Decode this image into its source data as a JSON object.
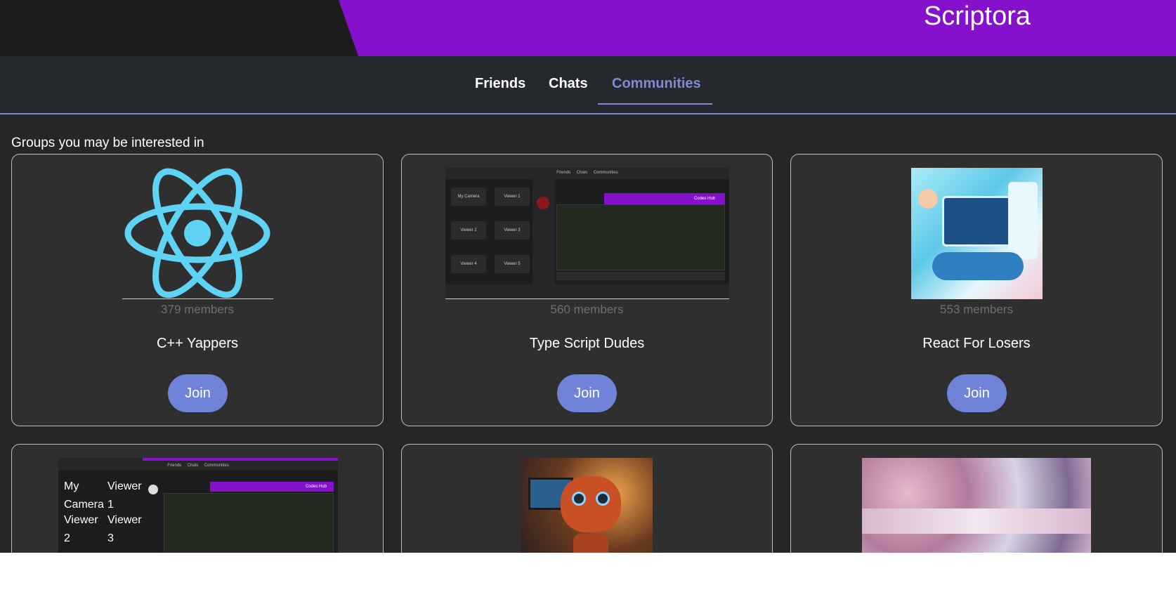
{
  "header": {
    "brand": "Scriptora"
  },
  "nav": {
    "tabs": [
      {
        "label": "Friends",
        "active": false
      },
      {
        "label": "Chats",
        "active": false
      },
      {
        "label": "Communities",
        "active": true
      }
    ]
  },
  "main": {
    "section_title": "Groups you may be interested in",
    "groups": [
      {
        "name": "C++ Yappers",
        "members": "379 members",
        "join_label": "Join",
        "image": "react-atom-logo"
      },
      {
        "name": "Type Script Dudes",
        "members": "560 members",
        "join_label": "Join",
        "image": "app-screenshot"
      },
      {
        "name": "React For Losers",
        "members": "553 members",
        "join_label": "Join",
        "image": "coding-illustration"
      }
    ]
  },
  "thumbnails": {
    "app_nav": [
      "Friends",
      "Chats",
      "Communities"
    ],
    "app_tiles": [
      "My Camera",
      "Viewer 1",
      "Viewer 2",
      "Viewer 3",
      "Viewer 4",
      "Viewer 5"
    ],
    "app_banner": "Codes Hub"
  },
  "colors": {
    "accent": "#7b8bd9",
    "brand_purple": "#8511cc",
    "join_button": "#6f83d8",
    "background": "#262626"
  }
}
